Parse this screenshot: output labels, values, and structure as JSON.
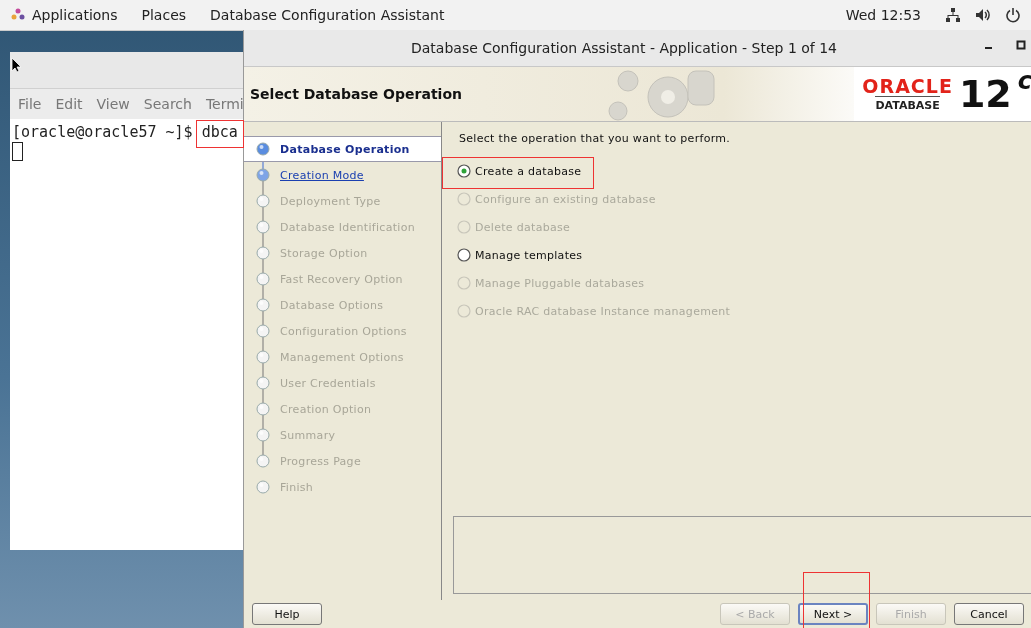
{
  "top_bar": {
    "menus": [
      "Applications",
      "Places",
      "Database Configuration Assistant"
    ],
    "clock": "Wed 12:53"
  },
  "terminal": {
    "menu": [
      "File",
      "Edit",
      "View",
      "Search",
      "Termi"
    ],
    "prompt": "[oracle@oracle57 ~]$",
    "command": "dbca"
  },
  "dialog": {
    "title": "Database Configuration Assistant - Application - Step 1 of 14",
    "header": {
      "title": "Select Database Operation",
      "logo_brand": "ORACLE",
      "logo_product": "DATABASE",
      "logo_version": "12",
      "logo_suffix": "c"
    },
    "steps": [
      {
        "label": "Database Operation",
        "selected": true,
        "disabled": false
      },
      {
        "label": "Creation Mode",
        "selected": false,
        "disabled": false
      },
      {
        "label": "Deployment Type",
        "selected": false,
        "disabled": true
      },
      {
        "label": "Database Identification",
        "selected": false,
        "disabled": true
      },
      {
        "label": "Storage Option",
        "selected": false,
        "disabled": true
      },
      {
        "label": "Fast Recovery Option",
        "selected": false,
        "disabled": true
      },
      {
        "label": "Database Options",
        "selected": false,
        "disabled": true
      },
      {
        "label": "Configuration Options",
        "selected": false,
        "disabled": true
      },
      {
        "label": "Management Options",
        "selected": false,
        "disabled": true
      },
      {
        "label": "User Credentials",
        "selected": false,
        "disabled": true
      },
      {
        "label": "Creation Option",
        "selected": false,
        "disabled": true
      },
      {
        "label": "Summary",
        "selected": false,
        "disabled": true
      },
      {
        "label": "Progress Page",
        "selected": false,
        "disabled": true
      },
      {
        "label": "Finish",
        "selected": false,
        "disabled": true
      }
    ],
    "instruction": "Select the operation that you want to perform.",
    "options": [
      {
        "label": "Create a database",
        "selected": true,
        "disabled": false
      },
      {
        "label": "Configure an existing database",
        "selected": false,
        "disabled": true
      },
      {
        "label": "Delete database",
        "selected": false,
        "disabled": true
      },
      {
        "label": "Manage templates",
        "selected": false,
        "disabled": false
      },
      {
        "label": "Manage Pluggable databases",
        "selected": false,
        "disabled": true
      },
      {
        "label": "Oracle RAC database Instance management",
        "selected": false,
        "disabled": true
      }
    ],
    "help_button": "Help",
    "buttons": [
      {
        "label": "< Back",
        "disabled": true,
        "default": false
      },
      {
        "label": "Next >",
        "disabled": false,
        "default": true
      },
      {
        "label": "Finish",
        "disabled": true,
        "default": false
      },
      {
        "label": "Cancel",
        "disabled": false,
        "default": false
      }
    ]
  }
}
